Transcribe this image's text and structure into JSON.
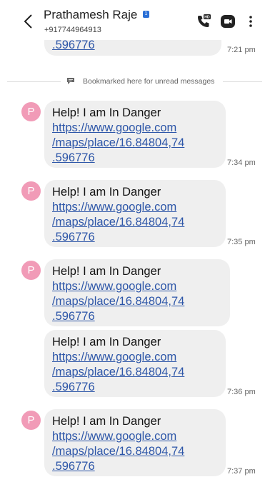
{
  "header": {
    "contact_name": "Prathamesh Raje",
    "sim_badge": "1",
    "contact_number": "+917744964913",
    "back_icon": "chevron-left-icon",
    "call_icon": "hd-call-icon",
    "video_icon": "video-call-icon",
    "more_icon": "more-vertical-icon"
  },
  "unread_marker": {
    "label": "Bookmarked here for unread messages",
    "icon": "bookmark-icon"
  },
  "avatar": {
    "letter": "P",
    "color": "#f19bb7"
  },
  "colors": {
    "link": "#2d56a8",
    "bubble": "#efefef"
  },
  "messages": [
    {
      "text": "",
      "link_lines": [
        ".596776"
      ],
      "time": "7:21 pm"
    },
    {
      "text": "Help! I am In Danger",
      "link_lines": [
        "https://www.google.com",
        "/maps/place/16.84804,74",
        ".596776"
      ],
      "time": "7:34 pm"
    },
    {
      "text": "Help! I am In Danger",
      "link_lines": [
        "https://www.google.com",
        "/maps/place/16.84804,74",
        ".596776"
      ],
      "time": "7:35 pm"
    },
    {
      "text": "Help! I am In Danger",
      "link_lines": [
        "https://www.google.com",
        "/maps/place/16.84804,74",
        ".596776"
      ],
      "time": ""
    },
    {
      "text": "Help! I am In Danger",
      "link_lines": [
        "https://www.google.com",
        "/maps/place/16.84804,74",
        ".596776"
      ],
      "time": "7:36 pm"
    },
    {
      "text": "Help! I am In Danger",
      "link_lines": [
        "https://www.google.com",
        "/maps/place/16.84804,74",
        ".596776"
      ],
      "time": "7:37 pm"
    }
  ]
}
